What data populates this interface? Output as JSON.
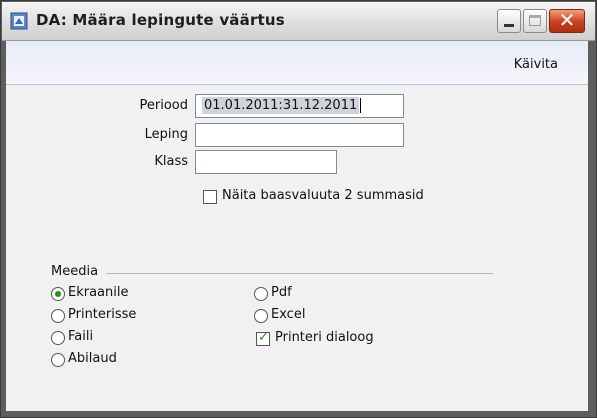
{
  "window": {
    "title": "DA: Määra lepingute väärtus",
    "minimize_icon": "minimize-icon",
    "maximize_icon": "maximize-icon",
    "close_icon": "close-icon",
    "close_glyph": "✕"
  },
  "toolbar": {
    "run_label": "Käivita"
  },
  "form": {
    "period_label": "Periood",
    "period_value": "01.01.2011:31.12.2011",
    "contract_label": "Leping",
    "contract_value": "",
    "class_label": "Klass",
    "class_value": "",
    "base_currency_label": "Näita baasvaluuta 2 summasid",
    "base_currency_checked": false
  },
  "media": {
    "group_label": "Meedia",
    "options": [
      {
        "label": "Ekraanile",
        "selected": true
      },
      {
        "label": "Printerisse",
        "selected": false
      },
      {
        "label": "Faili",
        "selected": false
      },
      {
        "label": "Abilaud",
        "selected": false
      },
      {
        "label": "Pdf",
        "selected": false
      },
      {
        "label": "Excel",
        "selected": false
      }
    ],
    "printer_dialog_label": "Printeri dialoog",
    "printer_dialog_checked": true
  },
  "colors": {
    "accent_green": "#2a8a1a",
    "close_red": "#c8401c"
  }
}
